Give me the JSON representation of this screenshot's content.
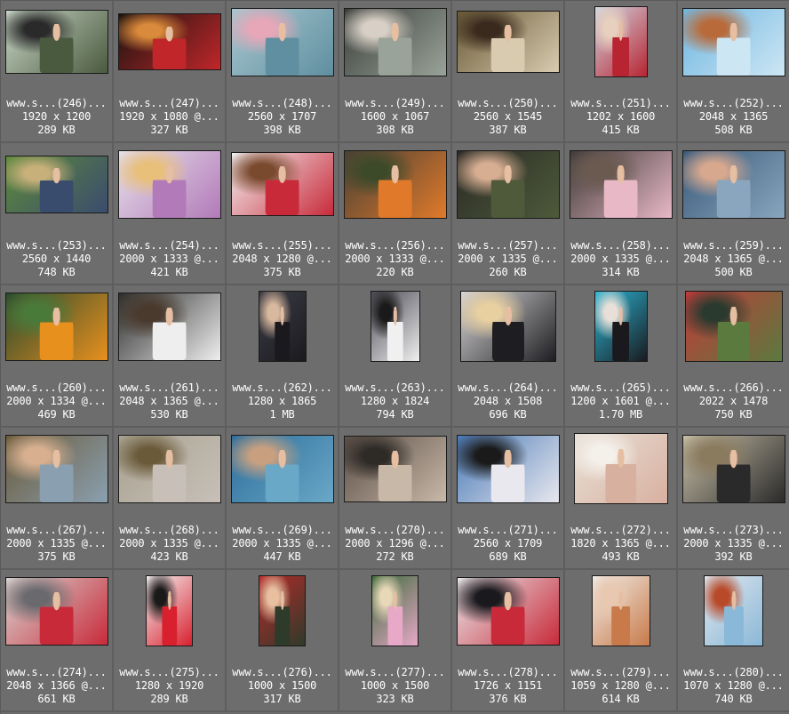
{
  "tiles": [
    {
      "name": "www.s...(246)...",
      "dims": "1920 x 1200",
      "size": "289 KB",
      "tw": 116,
      "th": 72,
      "colors": [
        "#c9d6c8",
        "#4a5a3e",
        "#2a2a2a"
      ]
    },
    {
      "name": "www.s...(247)...",
      "dims": "1920 x 1080 @...",
      "size": "327 KB",
      "tw": 116,
      "th": 64,
      "colors": [
        "#1a1410",
        "#c0262a",
        "#d98a3a"
      ]
    },
    {
      "name": "www.s...(248)...",
      "dims": "2560 x 1707",
      "size": "398 KB",
      "tw": 116,
      "th": 77,
      "colors": [
        "#a9c7cf",
        "#5f8fa0",
        "#e8a7b8"
      ]
    },
    {
      "name": "www.s...(249)...",
      "dims": "1600 x 1067",
      "size": "308 KB",
      "tw": 116,
      "th": 77,
      "colors": [
        "#3a3e3a",
        "#9aa39a",
        "#d8d0c6"
      ]
    },
    {
      "name": "www.s...(250)...",
      "dims": "2560 x 1545",
      "size": "387 KB",
      "tw": 116,
      "th": 70,
      "colors": [
        "#6a5a36",
        "#d8cbb0",
        "#3a2a1e"
      ]
    },
    {
      "name": "www.s...(251)...",
      "dims": "1202 x 1600",
      "size": "415 KB",
      "tw": 60,
      "th": 80,
      "colors": [
        "#cfd8e2",
        "#b82432",
        "#e8d0be"
      ]
    },
    {
      "name": "www.s...(252)...",
      "dims": "2048 x 1365",
      "size": "508 KB",
      "tw": 116,
      "th": 77,
      "colors": [
        "#6fb6e0",
        "#cde6f4",
        "#b86a3a"
      ]
    },
    {
      "name": "www.s...(253)...",
      "dims": "2560 x 1440",
      "size": "748 KB",
      "tw": 116,
      "th": 65,
      "colors": [
        "#5e8a3a",
        "#3a4c6e",
        "#c8b07a"
      ]
    },
    {
      "name": "www.s...(254)...",
      "dims": "2000 x 1333 @...",
      "size": "421 KB",
      "tw": 116,
      "th": 77,
      "colors": [
        "#e6e0ea",
        "#b27ab8",
        "#e8c07a"
      ]
    },
    {
      "name": "www.s...(255)...",
      "dims": "2048 x 1280 @...",
      "size": "375 KB",
      "tw": 116,
      "th": 72,
      "colors": [
        "#f2f2f2",
        "#c82a3a",
        "#7a4a2e"
      ]
    },
    {
      "name": "www.s...(256)...",
      "dims": "2000 x 1333 @...",
      "size": "220 KB",
      "tw": 116,
      "th": 77,
      "colors": [
        "#4a4036",
        "#e07a2a",
        "#3c4a2a"
      ]
    },
    {
      "name": "www.s...(257)...",
      "dims": "2000 x 1335 @...",
      "size": "260 KB",
      "tw": 116,
      "th": 77,
      "colors": [
        "#2a2a26",
        "#4e5a3a",
        "#d8ae92"
      ]
    },
    {
      "name": "www.s...(258)...",
      "dims": "2000 x 1335 @...",
      "size": "314 KB",
      "tw": 116,
      "th": 77,
      "colors": [
        "#3e3a38",
        "#e8b8c6",
        "#6a5a50"
      ]
    },
    {
      "name": "www.s...(259)...",
      "dims": "2048 x 1365 @...",
      "size": "500 KB",
      "tw": 116,
      "th": 77,
      "colors": [
        "#3a5a7a",
        "#8aa6be",
        "#d8a88e"
      ]
    },
    {
      "name": "www.s...(260)...",
      "dims": "2000 x 1334 @...",
      "size": "469 KB",
      "tw": 116,
      "th": 77,
      "colors": [
        "#2a4a2e",
        "#e8901e",
        "#4a7a3a"
      ]
    },
    {
      "name": "www.s...(261)...",
      "dims": "2048 x 1365 @...",
      "size": "530 KB",
      "tw": 116,
      "th": 77,
      "colors": [
        "#2c2e2c",
        "#eeeeee",
        "#4a3a2e"
      ]
    },
    {
      "name": "www.s...(262)...",
      "dims": "1280 x 1865",
      "size": "1 MB",
      "tw": 54,
      "th": 80,
      "colors": [
        "#3c3c46",
        "#1a1a1e",
        "#d8b89e"
      ]
    },
    {
      "name": "www.s...(263)...",
      "dims": "1280 x 1824",
      "size": "794 KB",
      "tw": 56,
      "th": 80,
      "colors": [
        "#4a4a54",
        "#f0f0f0",
        "#1a1a1a"
      ]
    },
    {
      "name": "www.s...(264)...",
      "dims": "2048 x 1508",
      "size": "696 KB",
      "tw": 108,
      "th": 80,
      "colors": [
        "#d8d6d6",
        "#1e1e22",
        "#e8d0a0"
      ]
    },
    {
      "name": "www.s...(265)...",
      "dims": "1200 x 1601 @...",
      "size": "1.70 MB",
      "tw": 60,
      "th": 80,
      "colors": [
        "#2ab6d6",
        "#1a1a1e",
        "#e8e0d8"
      ]
    },
    {
      "name": "www.s...(266)...",
      "dims": "2022 x 1478",
      "size": "750 KB",
      "tw": 110,
      "th": 80,
      "colors": [
        "#c23a3a",
        "#5a7a3e",
        "#2a3a2e"
      ]
    },
    {
      "name": "www.s...(267)...",
      "dims": "2000 x 1335 @...",
      "size": "375 KB",
      "tw": 116,
      "th": 77,
      "colors": [
        "#6a5a3a",
        "#8aa0b0",
        "#d8b090"
      ]
    },
    {
      "name": "www.s...(268)...",
      "dims": "2000 x 1335 @...",
      "size": "423 KB",
      "tw": 116,
      "th": 77,
      "colors": [
        "#a8a290",
        "#c8c0b8",
        "#6a5a3a"
      ]
    },
    {
      "name": "www.s...(269)...",
      "dims": "2000 x 1335 @...",
      "size": "447 KB",
      "tw": 116,
      "th": 77,
      "colors": [
        "#2e6e9a",
        "#6aa8c8",
        "#c8a080"
      ]
    },
    {
      "name": "www.s...(270)...",
      "dims": "2000 x 1296 @...",
      "size": "272 KB",
      "tw": 116,
      "th": 75,
      "colors": [
        "#5a4e46",
        "#c8b8a8",
        "#2e2a26"
      ]
    },
    {
      "name": "www.s...(271)...",
      "dims": "2560 x 1709",
      "size": "689 KB",
      "tw": 116,
      "th": 77,
      "colors": [
        "#4a7ab8",
        "#e8e8ee",
        "#1a1a1a"
      ]
    },
    {
      "name": "www.s...(272)...",
      "dims": "1820 x 1365 @...",
      "size": "493 KB",
      "tw": 106,
      "th": 80,
      "colors": [
        "#e8e0d6",
        "#d8b0a0",
        "#f4f0ea"
      ]
    },
    {
      "name": "www.s...(273)...",
      "dims": "2000 x 1335 @...",
      "size": "392 KB",
      "tw": 116,
      "th": 77,
      "colors": [
        "#c8c0a8",
        "#2a2a2a",
        "#8a7a5e"
      ]
    },
    {
      "name": "www.s...(274)...",
      "dims": "2048 x 1366 @...",
      "size": "661 KB",
      "tw": 116,
      "th": 77,
      "colors": [
        "#d8d4d0",
        "#c82a3a",
        "#6a6a6e"
      ]
    },
    {
      "name": "www.s...(275)...",
      "dims": "1280 x 1920",
      "size": "289 KB",
      "tw": 53,
      "th": 80,
      "colors": [
        "#f4f4f4",
        "#d8202e",
        "#1a1a1a"
      ]
    },
    {
      "name": "www.s...(276)...",
      "dims": "1000 x 1500",
      "size": "317 KB",
      "tw": 53,
      "th": 80,
      "colors": [
        "#b82a2a",
        "#2e3a2a",
        "#e8c0a0"
      ]
    },
    {
      "name": "www.s...(277)...",
      "dims": "1000 x 1500",
      "size": "323 KB",
      "tw": 53,
      "th": 80,
      "colors": [
        "#3a6a3a",
        "#e8a8c8",
        "#e8d8b8"
      ]
    },
    {
      "name": "www.s...(278)...",
      "dims": "1726 x 1151",
      "size": "376 KB",
      "tw": 116,
      "th": 77,
      "colors": [
        "#e8e8ea",
        "#c82a3a",
        "#1a1a1e"
      ]
    },
    {
      "name": "www.s...(279)...",
      "dims": "1059 x 1280 @...",
      "size": "614 KB",
      "tw": 66,
      "th": 80,
      "colors": [
        "#f0ece6",
        "#c87a4a",
        "#e8c8b0"
      ]
    },
    {
      "name": "www.s...(280)...",
      "dims": "1070 x 1280 @...",
      "size": "740 KB",
      "tw": 67,
      "th": 80,
      "colors": [
        "#dfe6ec",
        "#8ab8d8",
        "#b84a2a"
      ]
    }
  ]
}
